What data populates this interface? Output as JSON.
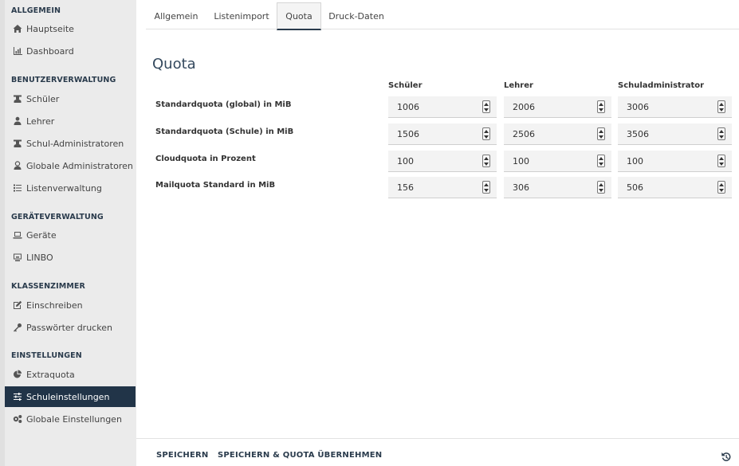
{
  "sidebar": {
    "sections": [
      {
        "title": "ALLGEMEIN",
        "items": [
          {
            "label": "Hauptseite",
            "icon": "home-icon"
          },
          {
            "label": "Dashboard",
            "icon": "chart-icon"
          }
        ]
      },
      {
        "title": "BENUTZERVERWALTUNG",
        "items": [
          {
            "label": "Schüler",
            "icon": "student-icon"
          },
          {
            "label": "Lehrer",
            "icon": "teacher-icon"
          },
          {
            "label": "Schul-Administratoren",
            "icon": "school-admin-icon"
          },
          {
            "label": "Globale Administratoren",
            "icon": "global-admin-icon"
          },
          {
            "label": "Listenverwaltung",
            "icon": "list-icon"
          }
        ]
      },
      {
        "title": "GERÄTEVERWALTUNG",
        "items": [
          {
            "label": "Geräte",
            "icon": "laptop-icon"
          },
          {
            "label": "LINBO",
            "icon": "linbo-icon"
          }
        ]
      },
      {
        "title": "KLASSENZIMMER",
        "items": [
          {
            "label": "Einschreiben",
            "icon": "edit-icon"
          },
          {
            "label": "Passwörter drucken",
            "icon": "key-icon"
          }
        ]
      },
      {
        "title": "EINSTELLUNGEN",
        "items": [
          {
            "label": "Extraquota",
            "icon": "pie-icon"
          },
          {
            "label": "Schuleinstellungen",
            "icon": "sliders-icon",
            "active": true
          },
          {
            "label": "Globale Einstellungen",
            "icon": "gears-icon"
          }
        ]
      }
    ]
  },
  "tabs": [
    {
      "label": "Allgemein"
    },
    {
      "label": "Listenimport"
    },
    {
      "label": "Quota",
      "active": true
    },
    {
      "label": "Druck-Daten"
    }
  ],
  "page": {
    "title": "Quota",
    "columns": [
      "Schüler",
      "Lehrer",
      "Schuladministrator"
    ],
    "rows": [
      {
        "label": "Standardquota (global) in MiB",
        "values": [
          "1006",
          "2006",
          "3006"
        ]
      },
      {
        "label": "Standardquota (Schule) in MiB",
        "values": [
          "1506",
          "2506",
          "3506"
        ]
      },
      {
        "label": "Cloudquota in Prozent",
        "values": [
          "100",
          "100",
          "100"
        ]
      },
      {
        "label": "Mailquota Standard in MiB",
        "values": [
          "156",
          "306",
          "506"
        ]
      }
    ]
  },
  "footer": {
    "save_label": "SPEICHERN",
    "save_apply_label": "SPEICHERN & QUOTA ÜBERNEHMEN",
    "history_icon": "history-icon"
  },
  "colors": {
    "accent": "#213448",
    "sidebar_bg": "#ebebeb"
  }
}
